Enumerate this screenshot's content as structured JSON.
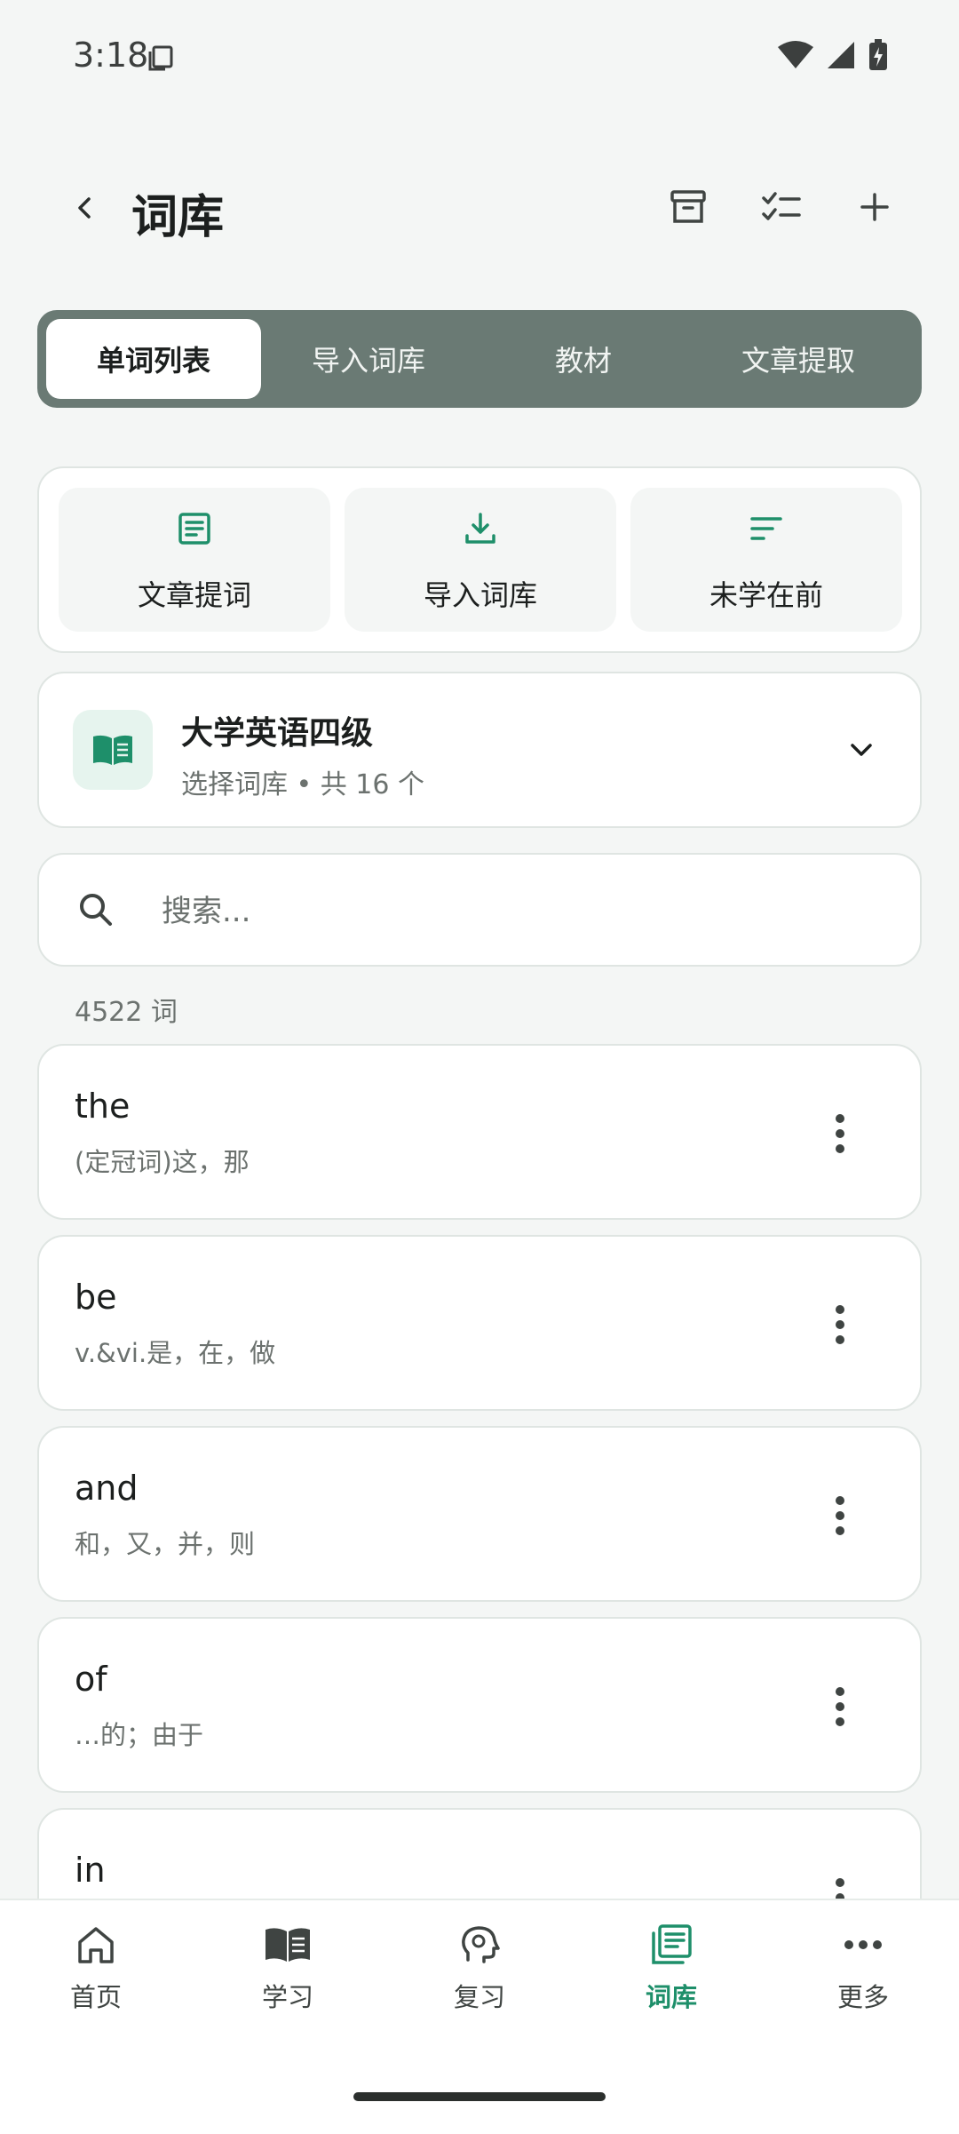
{
  "status": {
    "time": "3:18"
  },
  "header": {
    "title": "词库"
  },
  "tabs": [
    {
      "label": "单词列表",
      "active": true
    },
    {
      "label": "导入词库",
      "active": false
    },
    {
      "label": "教材",
      "active": false
    },
    {
      "label": "文章提取",
      "active": false
    }
  ],
  "quick_actions": [
    {
      "label": "文章提词",
      "icon": "article-icon"
    },
    {
      "label": "导入词库",
      "icon": "download-icon"
    },
    {
      "label": "未学在前",
      "icon": "sort-icon"
    }
  ],
  "wordbook": {
    "title": "大学英语四级",
    "subtitle": "选择词库 • 共 16 个"
  },
  "search": {
    "placeholder": "搜索..."
  },
  "word_count": "4522 词",
  "words": [
    {
      "word": "the",
      "meaning": "(定冠词)这，那"
    },
    {
      "word": "be",
      "meaning": "v.&vi.是，在，做"
    },
    {
      "word": "and",
      "meaning": "和，又，并，则"
    },
    {
      "word": "of",
      "meaning": "…的；由于"
    },
    {
      "word": "in",
      "meaning": ""
    }
  ],
  "bottom_nav": [
    {
      "label": "首页",
      "icon": "home-icon",
      "active": false
    },
    {
      "label": "学习",
      "icon": "book-open-icon",
      "active": false
    },
    {
      "label": "复习",
      "icon": "brain-icon",
      "active": false
    },
    {
      "label": "词库",
      "icon": "library-icon",
      "active": true
    },
    {
      "label": "更多",
      "icon": "more-horizontal-icon",
      "active": false
    }
  ],
  "colors": {
    "accent": "#1e8f6a",
    "tab_bg": "#6a7a74",
    "page_bg": "#f4f6f5"
  }
}
